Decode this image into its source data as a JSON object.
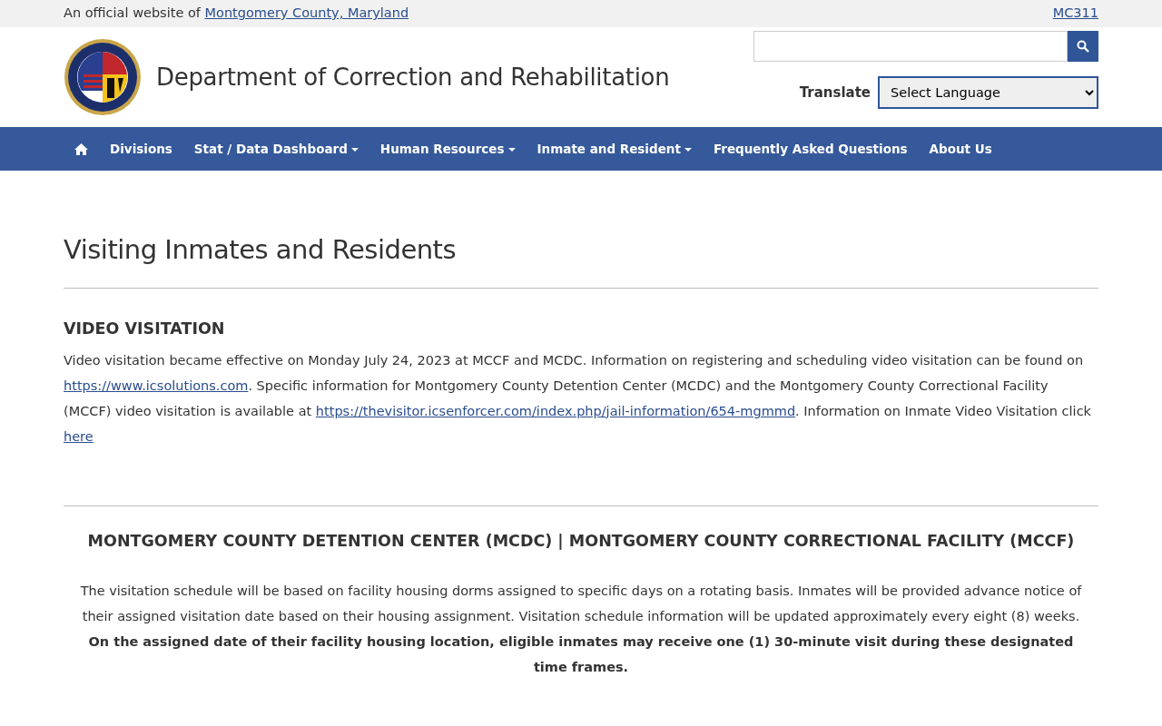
{
  "top_bar": {
    "text": "An official website of",
    "link": "Montgomery County, Maryland",
    "right_link": "MC311"
  },
  "header": {
    "title": "Department of Correction and Rehabilitation",
    "translate_label": "Translate",
    "language_select": "Select Language"
  },
  "nav": [
    {
      "kind": "home"
    },
    {
      "kind": "link",
      "label": "Divisions"
    },
    {
      "kind": "dropdown",
      "label": "Stat / Data Dashboard"
    },
    {
      "kind": "dropdown",
      "label": "Human Resources"
    },
    {
      "kind": "dropdown",
      "label": "Inmate and Resident"
    },
    {
      "kind": "link",
      "label": "Frequently Asked Questions"
    },
    {
      "kind": "link",
      "label": "About Us"
    }
  ],
  "page_title": "Visiting Inmates and Residents",
  "video_section": {
    "heading": "VIDEO VISITATION",
    "paragraph": [
      {
        "kind": "text",
        "text": "Video visitation became effective on Monday July 24, 2023 at MCCF and MCDC. Information on registering and scheduling video visitation can be found on "
      },
      {
        "kind": "link",
        "text": "https://www.icsolutions.com"
      },
      {
        "kind": "text",
        "text": ". Specific information for Montgomery County Detention Center (MCDC) and the Montgomery County Correctional Facility (MCCF) video visitation is available at "
      },
      {
        "kind": "link",
        "text": "https://thevisitor.icsenforcer.com/index.php/jail-information/654-mgmmd"
      },
      {
        "kind": "text",
        "text": ".  Information on Inmate Video Visitation click "
      },
      {
        "kind": "link",
        "text": "here"
      }
    ]
  },
  "facility_section": {
    "heading": "MONTGOMERY COUNTY DETENTION CENTER (MCDC) | MONTGOMERY COUNTY CORRECTIONAL FACILITY (MCCF)",
    "paragraphs": [
      "The visitation schedule will be based on facility housing dorms assigned to specific days on a rotating basis.  Inmates will be provided advance notice of their assigned visitation date based on their housing assignment. Visitation schedule information will be updated approximately every eight (8) weeks. **On the assigned date of their facility housing location, eligible inmates may receive one (1) 30-minute visit during these designated time frames.**"
    ]
  }
}
